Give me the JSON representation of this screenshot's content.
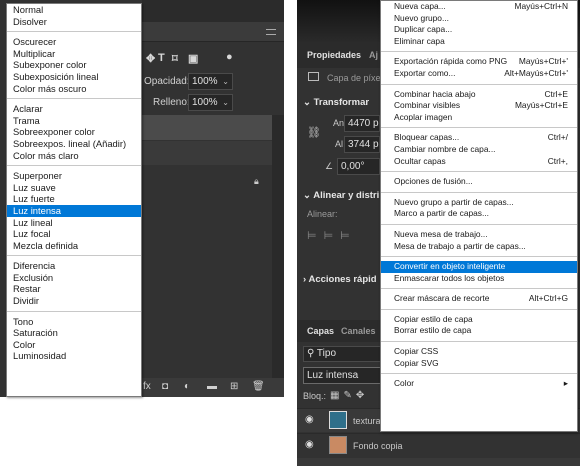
{
  "blend_modes": [
    {
      "label": "Normal"
    },
    {
      "label": "Disolver"
    },
    {
      "sep": true
    },
    {
      "label": "Oscurecer"
    },
    {
      "label": "Multiplicar"
    },
    {
      "label": "Subexponer color"
    },
    {
      "label": "Subexposición lineal"
    },
    {
      "label": "Color más oscuro"
    },
    {
      "sep": true
    },
    {
      "label": "Aclarar"
    },
    {
      "label": "Trama"
    },
    {
      "label": "Sobreexponer color"
    },
    {
      "label": "Sobreexpos. lineal (Añadir)"
    },
    {
      "label": "Color más claro"
    },
    {
      "sep": true
    },
    {
      "label": "Superponer"
    },
    {
      "label": "Luz suave"
    },
    {
      "label": "Luz fuerte"
    },
    {
      "label": "Luz intensa",
      "selected": true
    },
    {
      "label": "Luz lineal"
    },
    {
      "label": "Luz focal"
    },
    {
      "label": "Mezcla definida"
    },
    {
      "sep": true
    },
    {
      "label": "Diferencia"
    },
    {
      "label": "Exclusión"
    },
    {
      "label": "Restar"
    },
    {
      "label": "Dividir"
    },
    {
      "sep": true
    },
    {
      "label": "Tono"
    },
    {
      "label": "Saturación"
    },
    {
      "label": "Color"
    },
    {
      "label": "Luminosidad"
    }
  ],
  "left_panel": {
    "opacity_label": "Opacidad:",
    "opacity_value": "100%",
    "fill_label": "Relleno:",
    "fill_value": "100%"
  },
  "properties": {
    "tab_properties": "Propiedades",
    "tab_adjust": "Aj",
    "layer_type": "Capa de píxe",
    "transform_title": "Transformar",
    "w_label": "An",
    "w_value": "4470 p",
    "h_label": "Al",
    "h_value": "3744 p",
    "angle_value": "0,00°",
    "align_title": "Alinear y distri",
    "align_label": "Alinear:",
    "quick_actions_title": "Acciones rápid"
  },
  "layers_panel": {
    "tab_layers": "Capas",
    "tab_channels": "Canales",
    "search_placeholder": "Tipo",
    "blend_value": "Luz intensa",
    "lock_label": "Bloq.:",
    "layers": [
      {
        "name": "textura"
      },
      {
        "name": "Fondo copia"
      }
    ]
  },
  "context_menu": [
    {
      "label": "Nueva capa...",
      "shortcut": "Mayús+Ctrl+N"
    },
    {
      "label": "Nuevo grupo..."
    },
    {
      "label": "Duplicar capa..."
    },
    {
      "label": "Eliminar capa"
    },
    {
      "sep": true
    },
    {
      "label": "Exportación rápida como PNG",
      "shortcut": "Mayús+Ctrl+'"
    },
    {
      "label": "Exportar como...",
      "shortcut": "Alt+Mayús+Ctrl+'"
    },
    {
      "sep": true
    },
    {
      "label": "Combinar hacia abajo",
      "shortcut": "Ctrl+E"
    },
    {
      "label": "Combinar visibles",
      "shortcut": "Mayús+Ctrl+E"
    },
    {
      "label": "Acoplar imagen"
    },
    {
      "sep": true
    },
    {
      "label": "Bloquear capas...",
      "shortcut": "Ctrl+/"
    },
    {
      "label": "Cambiar nombre de capa..."
    },
    {
      "label": "Ocultar capas",
      "shortcut": "Ctrl+,"
    },
    {
      "sep": true
    },
    {
      "label": "Opciones de fusión..."
    },
    {
      "sep": true
    },
    {
      "label": "Nuevo grupo a partir de capas..."
    },
    {
      "label": "Marco a partir de capas..."
    },
    {
      "sep": true
    },
    {
      "label": "Nueva mesa de trabajo..."
    },
    {
      "label": "Mesa de trabajo a partir de capas..."
    },
    {
      "sep": true
    },
    {
      "label": "Convertir en objeto inteligente",
      "selected": true
    },
    {
      "label": "Enmascarar todos los objetos"
    },
    {
      "sep": true
    },
    {
      "label": "Crear máscara de recorte",
      "shortcut": "Alt+Ctrl+G"
    },
    {
      "sep": true
    },
    {
      "label": "Copiar estilo de capa"
    },
    {
      "label": "Borrar estilo de capa"
    },
    {
      "sep": true
    },
    {
      "label": "Copiar CSS"
    },
    {
      "label": "Copiar SVG"
    },
    {
      "sep": true
    },
    {
      "label": "Color",
      "submenu": true
    }
  ],
  "colors": {
    "panel_bg": "#323232",
    "selection": "#0078d7"
  }
}
